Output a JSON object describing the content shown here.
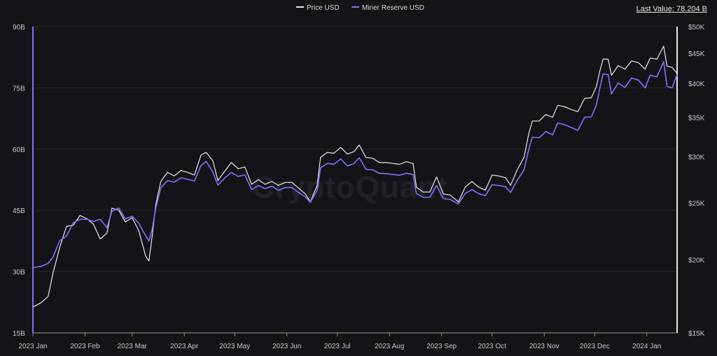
{
  "legend": {
    "price_label": "Price USD",
    "reserve_label": "Miner Reserve USD"
  },
  "last_value": "Last Value: 78.204 B",
  "watermark": "CryptoQuant",
  "colors": {
    "price": "#e8e8e8",
    "reserve": "#7b73ff",
    "background": "#141418",
    "grid": "#2a2a2e"
  },
  "chart_data": {
    "type": "line",
    "left_axis": {
      "ticks": [
        "90B",
        "75B",
        "60B",
        "45B",
        "30B",
        "15B"
      ],
      "values": [
        90,
        75,
        60,
        45,
        30,
        15
      ],
      "ylim": [
        15,
        90
      ],
      "unit": "B"
    },
    "right_axis": {
      "scale": "log",
      "ticks": [
        "$50K",
        "$45K",
        "$40K",
        "$35K",
        "$30K",
        "$25K",
        "$20K",
        "$15K"
      ],
      "values": [
        50000,
        45000,
        40000,
        35000,
        30000,
        25000,
        20000,
        15000
      ],
      "ylim": [
        15000,
        50000
      ]
    },
    "x_ticks": [
      "2023 Jan",
      "2023 Feb",
      "2023 Mar",
      "2023 Apr",
      "2023 May",
      "2023 Jun",
      "2023 Jul",
      "2023 Aug",
      "2023 Sep",
      "2023 Oct",
      "2023 Nov",
      "2023 Dec",
      "2024 Jan"
    ],
    "x_start": "2023-01-01",
    "x_end": "2024-01-19",
    "grid": true,
    "legend_position": "top-center",
    "series": [
      {
        "name": "Price USD",
        "axis": "right",
        "points": [
          [
            "2023-01-01",
            16600
          ],
          [
            "2023-01-06",
            16900
          ],
          [
            "2023-01-10",
            17300
          ],
          [
            "2023-01-13",
            19000
          ],
          [
            "2023-01-17",
            21000
          ],
          [
            "2023-01-21",
            22800
          ],
          [
            "2023-01-25",
            22900
          ],
          [
            "2023-01-29",
            23800
          ],
          [
            "2023-02-02",
            23500
          ],
          [
            "2023-02-06",
            23000
          ],
          [
            "2023-02-10",
            21700
          ],
          [
            "2023-02-14",
            22200
          ],
          [
            "2023-02-17",
            24500
          ],
          [
            "2023-02-21",
            24300
          ],
          [
            "2023-02-25",
            23200
          ],
          [
            "2023-03-01",
            23600
          ],
          [
            "2023-03-05",
            22400
          ],
          [
            "2023-03-09",
            20300
          ],
          [
            "2023-03-11",
            19900
          ],
          [
            "2023-03-13",
            22000
          ],
          [
            "2023-03-15",
            24800
          ],
          [
            "2023-03-18",
            27200
          ],
          [
            "2023-03-22",
            28200
          ],
          [
            "2023-03-26",
            27800
          ],
          [
            "2023-03-30",
            28400
          ],
          [
            "2023-04-03",
            28200
          ],
          [
            "2023-04-07",
            27900
          ],
          [
            "2023-04-11",
            30200
          ],
          [
            "2023-04-14",
            30500
          ],
          [
            "2023-04-18",
            29500
          ],
          [
            "2023-04-21",
            27300
          ],
          [
            "2023-04-25",
            28300
          ],
          [
            "2023-04-29",
            29300
          ],
          [
            "2023-05-03",
            28600
          ],
          [
            "2023-05-07",
            28800
          ],
          [
            "2023-05-11",
            26900
          ],
          [
            "2023-05-15",
            27400
          ],
          [
            "2023-05-19",
            26900
          ],
          [
            "2023-05-23",
            27200
          ],
          [
            "2023-05-27",
            26800
          ],
          [
            "2023-05-31",
            27100
          ],
          [
            "2023-06-04",
            27100
          ],
          [
            "2023-06-08",
            26500
          ],
          [
            "2023-06-12",
            25900
          ],
          [
            "2023-06-15",
            25100
          ],
          [
            "2023-06-19",
            26800
          ],
          [
            "2023-06-21",
            29900
          ],
          [
            "2023-06-25",
            30500
          ],
          [
            "2023-06-29",
            30400
          ],
          [
            "2023-07-03",
            31100
          ],
          [
            "2023-07-07",
            30300
          ],
          [
            "2023-07-11",
            30600
          ],
          [
            "2023-07-14",
            31400
          ],
          [
            "2023-07-18",
            29900
          ],
          [
            "2023-07-22",
            29800
          ],
          [
            "2023-07-26",
            29300
          ],
          [
            "2023-07-30",
            29300
          ],
          [
            "2023-08-03",
            29200
          ],
          [
            "2023-08-07",
            29100
          ],
          [
            "2023-08-11",
            29400
          ],
          [
            "2023-08-15",
            29200
          ],
          [
            "2023-08-17",
            26600
          ],
          [
            "2023-08-21",
            26100
          ],
          [
            "2023-08-25",
            26100
          ],
          [
            "2023-08-29",
            27700
          ],
          [
            "2023-09-02",
            25900
          ],
          [
            "2023-09-06",
            25800
          ],
          [
            "2023-09-11",
            25100
          ],
          [
            "2023-09-15",
            26600
          ],
          [
            "2023-09-19",
            27200
          ],
          [
            "2023-09-23",
            26600
          ],
          [
            "2023-09-27",
            26300
          ],
          [
            "2023-10-01",
            27900
          ],
          [
            "2023-10-05",
            27800
          ],
          [
            "2023-10-09",
            27600
          ],
          [
            "2023-10-12",
            26800
          ],
          [
            "2023-10-16",
            28500
          ],
          [
            "2023-10-20",
            29900
          ],
          [
            "2023-10-23",
            33000
          ],
          [
            "2023-10-25",
            34500
          ],
          [
            "2023-10-29",
            34500
          ],
          [
            "2023-11-02",
            35400
          ],
          [
            "2023-11-06",
            35000
          ],
          [
            "2023-11-09",
            36700
          ],
          [
            "2023-11-13",
            36500
          ],
          [
            "2023-11-17",
            36100
          ],
          [
            "2023-11-21",
            35800
          ],
          [
            "2023-11-25",
            37700
          ],
          [
            "2023-11-29",
            37800
          ],
          [
            "2023-12-02",
            39500
          ],
          [
            "2023-12-04",
            41900
          ],
          [
            "2023-12-06",
            44000
          ],
          [
            "2023-12-09",
            44000
          ],
          [
            "2023-12-11",
            41300
          ],
          [
            "2023-12-15",
            42900
          ],
          [
            "2023-12-19",
            42300
          ],
          [
            "2023-12-23",
            43700
          ],
          [
            "2023-12-27",
            43400
          ],
          [
            "2023-12-31",
            42300
          ],
          [
            "2024-01-03",
            44200
          ],
          [
            "2024-01-07",
            44000
          ],
          [
            "2024-01-11",
            46300
          ],
          [
            "2024-01-13",
            42800
          ],
          [
            "2024-01-16",
            42600
          ],
          [
            "2024-01-19",
            41600
          ]
        ]
      },
      {
        "name": "Miner Reserve USD",
        "axis": "left",
        "points": [
          [
            "2023-01-01",
            31.0
          ],
          [
            "2023-01-06",
            31.3
          ],
          [
            "2023-01-10",
            32.0
          ],
          [
            "2023-01-13",
            33.6
          ],
          [
            "2023-01-17",
            37.6
          ],
          [
            "2023-01-21",
            38.7
          ],
          [
            "2023-01-25",
            42.0
          ],
          [
            "2023-01-29",
            42.8
          ],
          [
            "2023-02-02",
            42.8
          ],
          [
            "2023-02-06",
            42.3
          ],
          [
            "2023-02-10",
            42.8
          ],
          [
            "2023-02-14",
            40.8
          ],
          [
            "2023-02-17",
            44.8
          ],
          [
            "2023-02-21",
            45.6
          ],
          [
            "2023-02-25",
            42.9
          ],
          [
            "2023-03-01",
            43.6
          ],
          [
            "2023-03-05",
            41.8
          ],
          [
            "2023-03-09",
            38.8
          ],
          [
            "2023-03-11",
            37.5
          ],
          [
            "2023-03-13",
            40.5
          ],
          [
            "2023-03-15",
            45.5
          ],
          [
            "2023-03-18",
            50.5
          ],
          [
            "2023-03-22",
            52.3
          ],
          [
            "2023-03-26",
            51.9
          ],
          [
            "2023-03-30",
            53.0
          ],
          [
            "2023-04-03",
            52.6
          ],
          [
            "2023-04-07",
            52.2
          ],
          [
            "2023-04-11",
            56.0
          ],
          [
            "2023-04-14",
            57.0
          ],
          [
            "2023-04-18",
            54.4
          ],
          [
            "2023-04-21",
            51.2
          ],
          [
            "2023-04-25",
            52.9
          ],
          [
            "2023-04-29",
            54.3
          ],
          [
            "2023-05-03",
            53.3
          ],
          [
            "2023-05-07",
            53.7
          ],
          [
            "2023-05-11",
            50.1
          ],
          [
            "2023-05-15",
            51.1
          ],
          [
            "2023-05-19",
            50.3
          ],
          [
            "2023-05-23",
            50.9
          ],
          [
            "2023-05-27",
            49.9
          ],
          [
            "2023-05-31",
            50.6
          ],
          [
            "2023-06-04",
            50.6
          ],
          [
            "2023-06-08",
            49.4
          ],
          [
            "2023-06-12",
            48.3
          ],
          [
            "2023-06-15",
            47.0
          ],
          [
            "2023-06-19",
            49.9
          ],
          [
            "2023-06-21",
            55.4
          ],
          [
            "2023-06-25",
            56.5
          ],
          [
            "2023-06-29",
            56.3
          ],
          [
            "2023-07-03",
            57.6
          ],
          [
            "2023-07-07",
            55.9
          ],
          [
            "2023-07-11",
            56.5
          ],
          [
            "2023-07-14",
            57.9
          ],
          [
            "2023-07-18",
            55.1
          ],
          [
            "2023-07-22",
            54.9
          ],
          [
            "2023-07-26",
            54.1
          ],
          [
            "2023-07-30",
            54.0
          ],
          [
            "2023-08-03",
            53.8
          ],
          [
            "2023-08-07",
            53.6
          ],
          [
            "2023-08-11",
            54.1
          ],
          [
            "2023-08-15",
            53.8
          ],
          [
            "2023-08-17",
            49.1
          ],
          [
            "2023-08-21",
            48.2
          ],
          [
            "2023-08-25",
            48.2
          ],
          [
            "2023-08-29",
            51.1
          ],
          [
            "2023-09-02",
            47.9
          ],
          [
            "2023-09-06",
            47.7
          ],
          [
            "2023-09-11",
            46.6
          ],
          [
            "2023-09-15",
            49.1
          ],
          [
            "2023-09-19",
            50.1
          ],
          [
            "2023-09-23",
            49.1
          ],
          [
            "2023-09-27",
            48.6
          ],
          [
            "2023-10-01",
            51.3
          ],
          [
            "2023-10-05",
            51.1
          ],
          [
            "2023-10-09",
            50.8
          ],
          [
            "2023-10-12",
            49.4
          ],
          [
            "2023-10-16",
            52.4
          ],
          [
            "2023-10-20",
            54.9
          ],
          [
            "2023-10-23",
            60.3
          ],
          [
            "2023-10-25",
            62.9
          ],
          [
            "2023-10-29",
            62.8
          ],
          [
            "2023-11-02",
            64.3
          ],
          [
            "2023-11-06",
            63.5
          ],
          [
            "2023-11-09",
            66.4
          ],
          [
            "2023-11-13",
            66.0
          ],
          [
            "2023-11-17",
            65.3
          ],
          [
            "2023-11-21",
            64.6
          ],
          [
            "2023-11-25",
            67.8
          ],
          [
            "2023-11-29",
            67.9
          ],
          [
            "2023-12-02",
            70.8
          ],
          [
            "2023-12-04",
            74.8
          ],
          [
            "2023-12-06",
            78.4
          ],
          [
            "2023-12-09",
            78.3
          ],
          [
            "2023-12-11",
            73.5
          ],
          [
            "2023-12-15",
            76.2
          ],
          [
            "2023-12-19",
            75.1
          ],
          [
            "2023-12-23",
            77.4
          ],
          [
            "2023-12-27",
            76.9
          ],
          [
            "2023-12-31",
            75.0
          ],
          [
            "2024-01-03",
            78.1
          ],
          [
            "2024-01-07",
            77.7
          ],
          [
            "2024-01-11",
            81.4
          ],
          [
            "2024-01-13",
            75.4
          ],
          [
            "2024-01-16",
            75.0
          ],
          [
            "2024-01-19",
            78.2
          ]
        ]
      }
    ]
  }
}
